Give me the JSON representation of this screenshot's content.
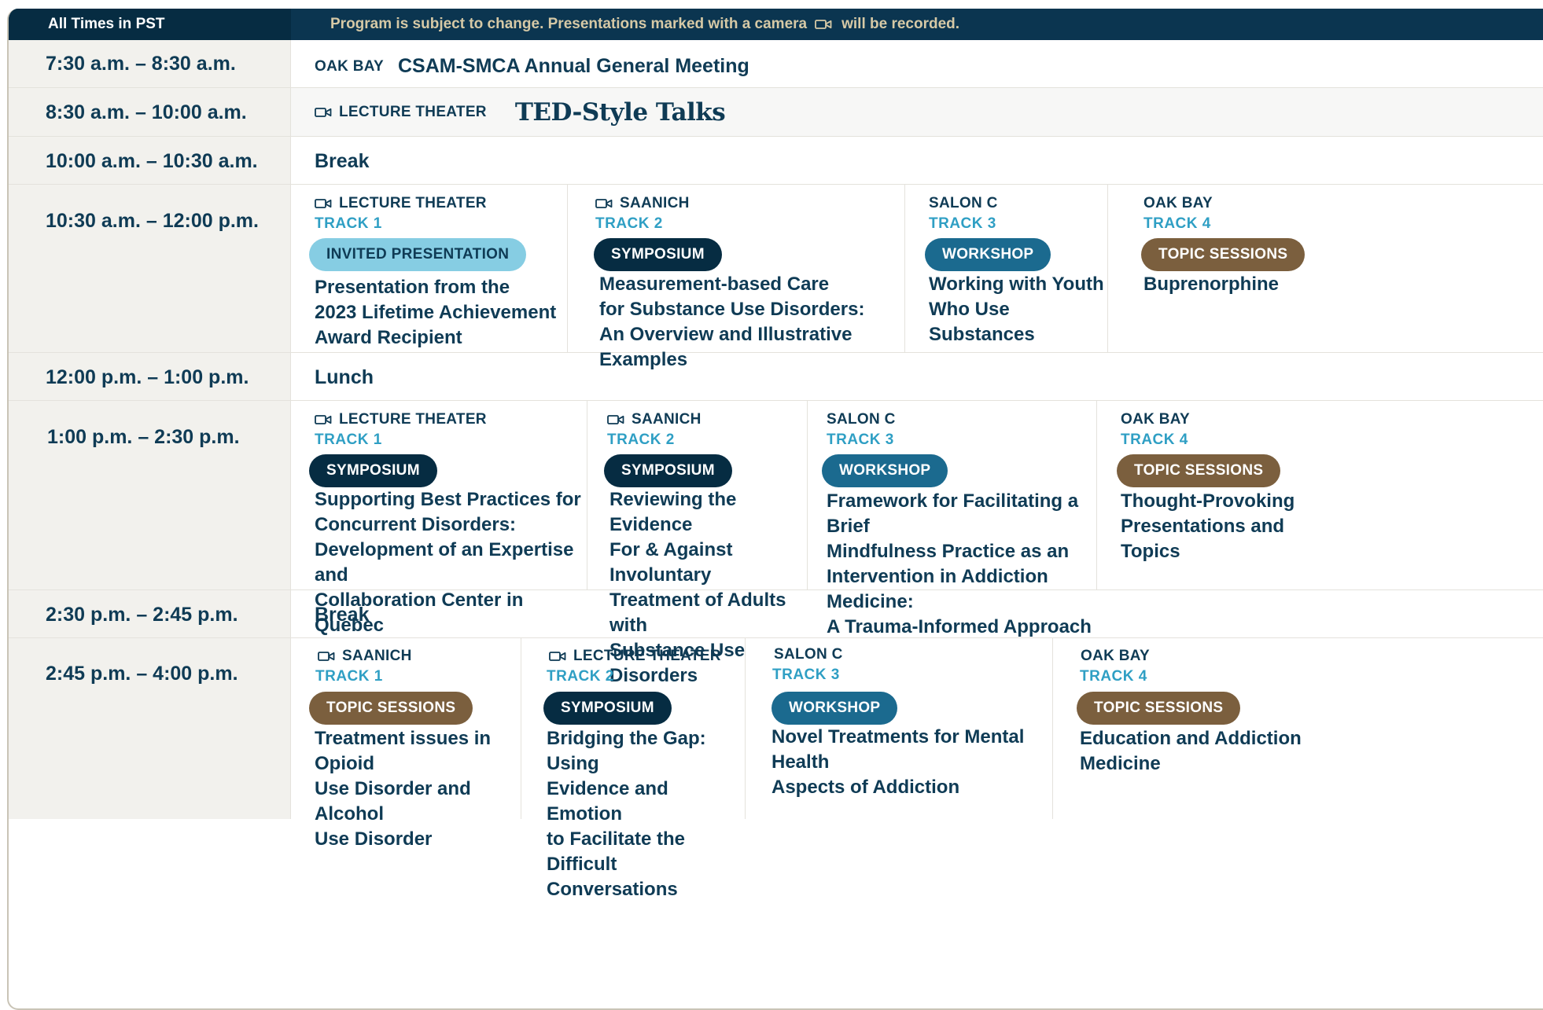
{
  "header": {
    "timezone": "All Times in PST",
    "note_part1": "Program is subject to change.",
    "note_part2": "Presentations marked with a camera",
    "note_part3": "will be recorded."
  },
  "rows": [
    {
      "time": "7:30 a.m. – 8:30 a.m.",
      "room": "OAK BAY",
      "title": "CSAM-SMCA Annual General Meeting"
    },
    {
      "time": "8:30 a.m. – 10:00 a.m.",
      "room": "LECTURE THEATER",
      "title": "TED-Style Talks"
    },
    {
      "time": "10:00 a.m. – 10:30 a.m.",
      "title": "Break"
    },
    {
      "time": "10:30 a.m. – 12:00 p.m.",
      "sessions": [
        {
          "room": "LECTURE THEATER",
          "track": "TRACK 1",
          "type": "INVITED PRESENTATION",
          "title_lines": [
            "Presentation from the",
            "2023 Lifetime Achievement",
            "Award Recipient"
          ]
        },
        {
          "room": "SAANICH",
          "track": "TRACK 2",
          "type": "SYMPOSIUM",
          "title_lines": [
            "Measurement-based Care",
            "for Substance Use Disorders:",
            "An Overview and Illustrative Examples"
          ]
        },
        {
          "room": "SALON C",
          "track": "TRACK 3",
          "type": "WORKSHOP",
          "title_lines": [
            "Working with Youth",
            "Who Use Substances"
          ]
        },
        {
          "room": "OAK BAY",
          "track": "TRACK 4",
          "type": "TOPIC SESSIONS",
          "title_lines": [
            "Buprenorphine"
          ]
        }
      ]
    },
    {
      "time": "12:00 p.m. – 1:00 p.m.",
      "title": "Lunch"
    },
    {
      "time": "1:00 p.m. – 2:30 p.m.",
      "sessions": [
        {
          "room": "LECTURE THEATER",
          "track": "TRACK 1",
          "type": "SYMPOSIUM",
          "title_lines": [
            "Supporting Best Practices for",
            "Concurrent Disorders:",
            "Development of an Expertise and",
            "Collaboration Center in Quebec"
          ]
        },
        {
          "room": "SAANICH",
          "track": "TRACK 2",
          "type": "SYMPOSIUM",
          "title_lines": [
            "Reviewing the Evidence",
            "For & Against Involuntary",
            "Treatment of Adults with",
            "Substance Use Disorders"
          ]
        },
        {
          "room": "SALON C",
          "track": "TRACK 3",
          "type": "WORKSHOP",
          "title_lines": [
            "Framework for Facilitating a Brief",
            "Mindfulness Practice as an",
            "Intervention in Addiction Medicine:",
            "A Trauma-Informed Approach"
          ]
        },
        {
          "room": "OAK BAY",
          "track": "TRACK 4",
          "type": "TOPIC SESSIONS",
          "title_lines": [
            "Thought-Provoking",
            "Presentations and",
            "Topics"
          ]
        }
      ]
    },
    {
      "time": "2:30 p.m. – 2:45 p.m.",
      "title": "Break"
    },
    {
      "time": "2:45 p.m. – 4:00 p.m.",
      "sessions": [
        {
          "room": "SAANICH",
          "track": "TRACK 1",
          "type": "TOPIC SESSIONS",
          "title_lines": [
            "Treatment issues in Opioid",
            "Use Disorder and Alcohol",
            "Use Disorder"
          ]
        },
        {
          "room": "LECTURE THEATER",
          "track": "TRACK 2",
          "type": "SYMPOSIUM",
          "title_lines": [
            "Bridging the Gap: Using",
            "Evidence and Emotion",
            "to Facilitate the Difficult",
            "Conversations"
          ]
        },
        {
          "room": "SALON C",
          "track": "TRACK 3",
          "type": "WORKSHOP",
          "title_lines": [
            "Novel Treatments for Mental Health",
            "Aspects of Addiction"
          ]
        },
        {
          "room": "OAK BAY",
          "track": "TRACK 4",
          "type": "TOPIC SESSIONS",
          "title_lines": [
            "Education and Addiction",
            "Medicine"
          ]
        }
      ]
    }
  ]
}
